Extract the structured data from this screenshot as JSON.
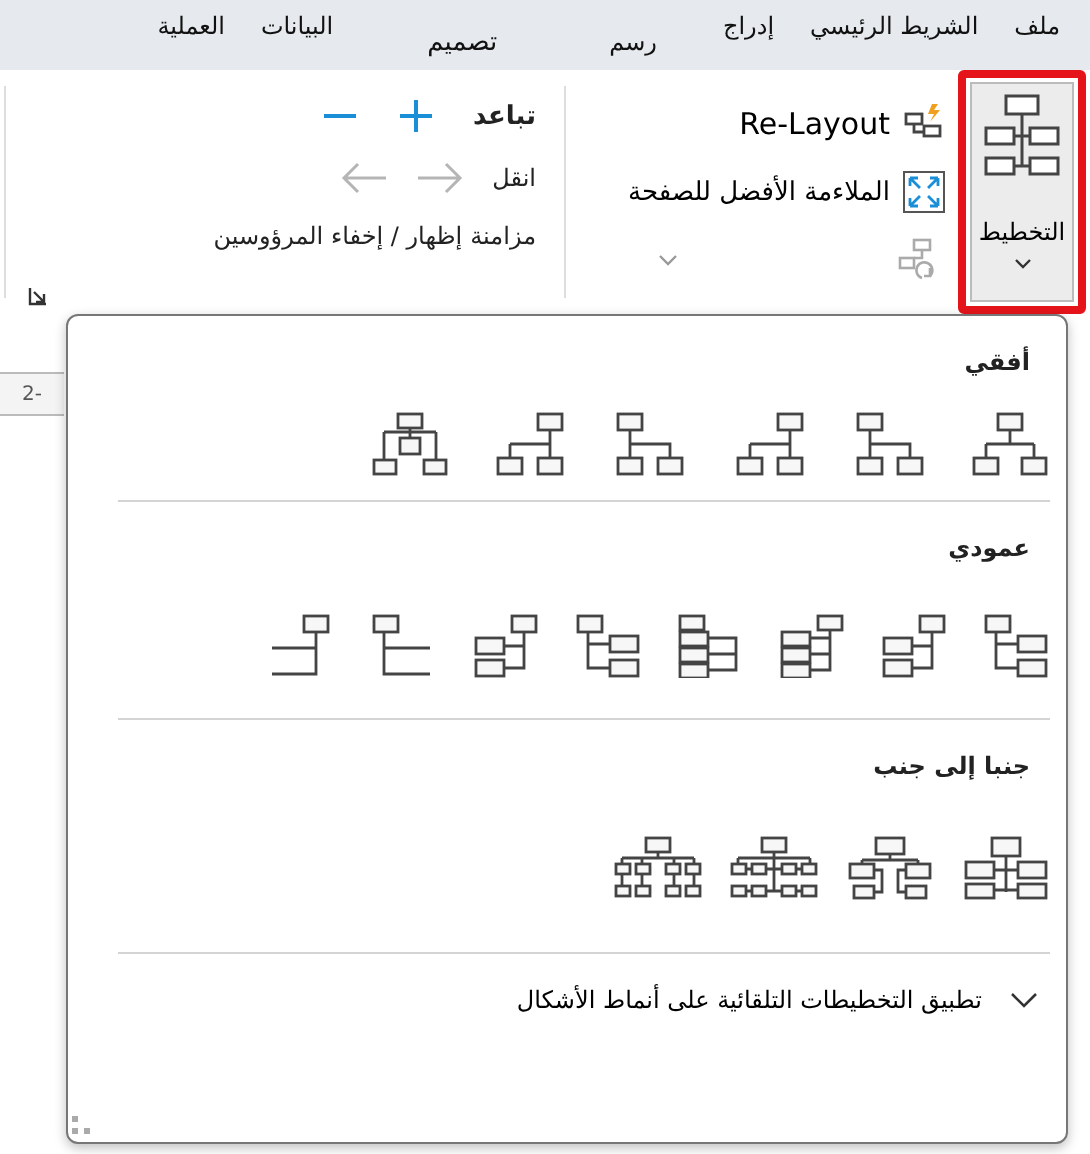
{
  "tabs": [
    {
      "label": "ملف"
    },
    {
      "label": "الشريط الرئيسي"
    },
    {
      "label": "إدراج"
    },
    {
      "label": "رسم"
    },
    {
      "label": "تصميم"
    },
    {
      "label": "البيانات"
    },
    {
      "label": "العملية"
    }
  ],
  "ribbon": {
    "layout_button": {
      "label": "التخطيط",
      "highlighted": true
    },
    "relayout": {
      "label": "Re-Layout"
    },
    "fit_page": {
      "label": "الملاءمة الأفضل للصفحة"
    },
    "spacing": {
      "label": "تباعد"
    },
    "move": {
      "label": "انقل",
      "disabled": true
    },
    "sync": {
      "label": "مزامنة"
    },
    "show_hide": {
      "label": "إظهار / إخفاء المرؤوسين"
    }
  },
  "ruler": {
    "label": "-2"
  },
  "dropdown": {
    "sections": [
      {
        "title": "أفقي",
        "kind": "horizontal"
      },
      {
        "title": "عمودي",
        "kind": "vertical"
      },
      {
        "title": "جنبا إلى جنب",
        "kind": "side"
      }
    ],
    "footer": {
      "label": "تطبيق التخطيطات التلقائية على أنماط الأشكال",
      "expanded": false
    }
  }
}
